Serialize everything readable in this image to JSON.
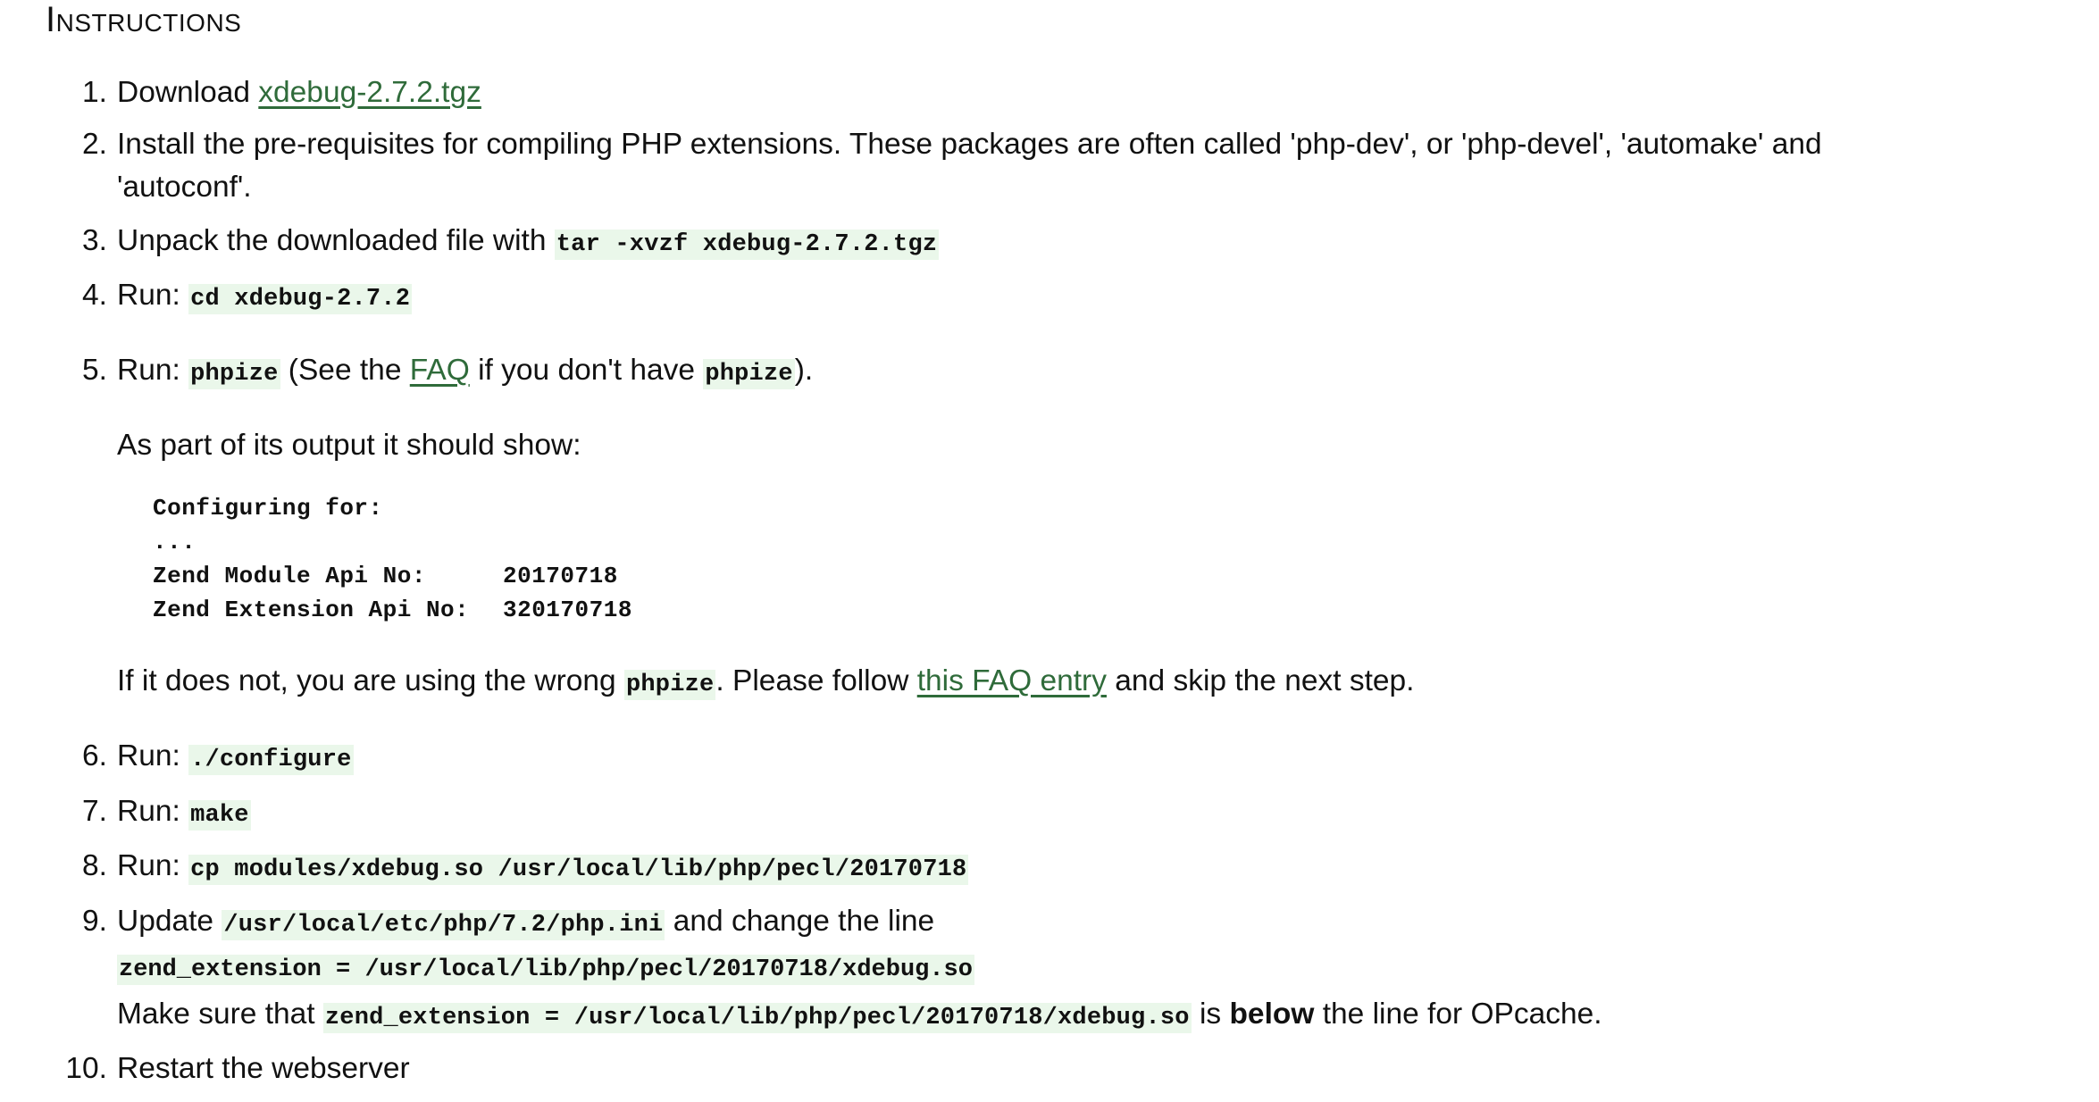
{
  "heading": "Instructions",
  "steps": {
    "s1": {
      "num": "1.",
      "text": "Download ",
      "link": "xdebug-2.7.2.tgz"
    },
    "s2": {
      "num": "2.",
      "line1": "Install the pre-requisites for compiling PHP extensions. These packages are often called 'php-dev', or 'php-devel', 'automake' and",
      "line2": "'autoconf'."
    },
    "s3": {
      "num": "3.",
      "text": "Unpack the downloaded file with ",
      "code": "tar -xvzf xdebug-2.7.2.tgz"
    },
    "s4": {
      "num": "4.",
      "text": "Run: ",
      "code": "cd xdebug-2.7.2"
    },
    "s5": {
      "num": "5.",
      "text": "Run: ",
      "code": "phpize",
      "mid1": " (See the ",
      "link": "FAQ",
      "mid2": " if you don't have ",
      "code2": "phpize",
      "end": ").",
      "output_intro": "As part of its output it should show:",
      "output": {
        "l1": "Configuring for:",
        "l2": "...",
        "l3_label": "Zend Module Api No:",
        "l3_value": "20170718",
        "l4_label": "Zend Extension Api No:",
        "l4_value": "320170718"
      },
      "notice_pre": "If it does not, you are using the wrong ",
      "notice_code": "phpize",
      "notice_mid": ". Please follow ",
      "notice_link": "this FAQ entry",
      "notice_end": " and skip the next step."
    },
    "s6": {
      "num": "6.",
      "text": "Run: ",
      "code": "./configure"
    },
    "s7": {
      "num": "7.",
      "text": "Run: ",
      "code": "make"
    },
    "s8": {
      "num": "8.",
      "text": "Run: ",
      "code": "cp modules/xdebug.so /usr/local/lib/php/pecl/20170718"
    },
    "s9": {
      "num": "9.",
      "text": "Update ",
      "code": "/usr/local/etc/php/7.2/php.ini",
      "end": " and change the line",
      "line_code": "zend_extension = /usr/local/lib/php/pecl/20170718/xdebug.so",
      "note_pre": "Make sure that ",
      "note_code": "zend_extension = /usr/local/lib/php/pecl/20170718/xdebug.so",
      "note_mid": " is ",
      "note_bold": "below",
      "note_end": " the line for OPcache."
    },
    "s10": {
      "num": "10.",
      "text": "Restart the webserver"
    }
  },
  "colors": {
    "link": "#2f6b3a",
    "code_bg": "#eaf7ea",
    "text": "#111111"
  }
}
